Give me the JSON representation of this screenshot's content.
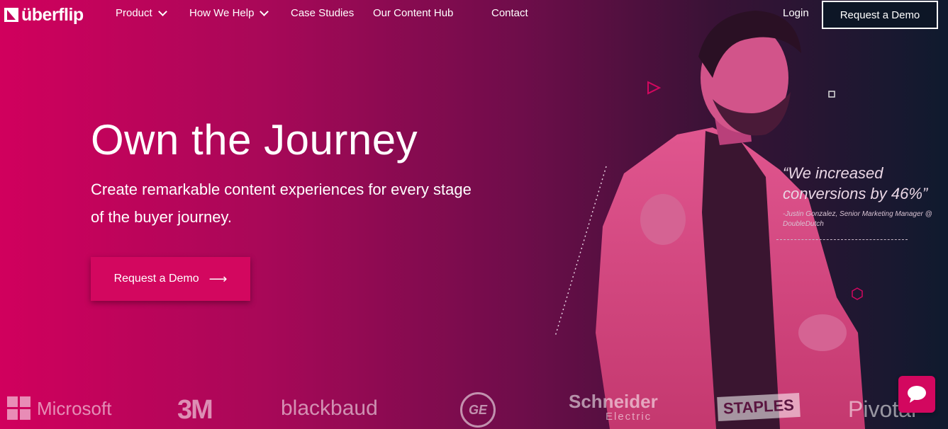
{
  "nav": {
    "logo_text": "überflip",
    "items": [
      {
        "label": "Product"
      },
      {
        "label": "How We Help"
      },
      {
        "label": "Case Studies"
      },
      {
        "label": "Our Content Hub"
      },
      {
        "label": "Contact"
      }
    ],
    "login": "Login",
    "demo": "Request a Demo"
  },
  "hero": {
    "title": "Own the Journey",
    "subtitle": "Create remarkable content experiences for every stage of the buyer journey.",
    "cta": "Request a Demo"
  },
  "quote": {
    "text": "“We increased conversions by 46%”",
    "attribution": "-Justin Gonzalez, Senior Marketing Manager @ DoubleDutch"
  },
  "logos": [
    "Microsoft",
    "3M",
    "blackbaud",
    "GE",
    "Schneider",
    "Electric",
    "STAPLES",
    "Pivotal"
  ],
  "colors": {
    "accent": "#d3075f",
    "dark": "#0d1626"
  }
}
